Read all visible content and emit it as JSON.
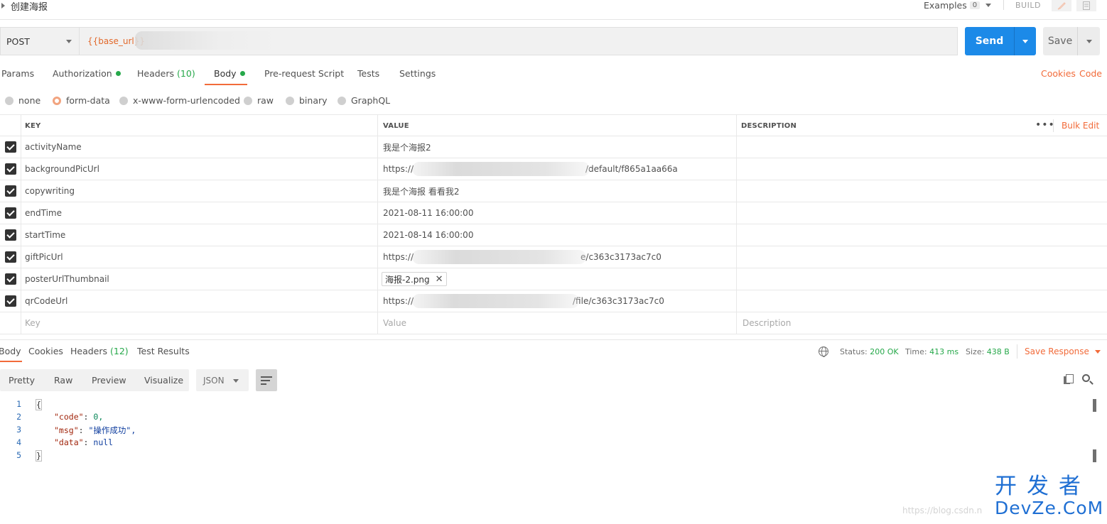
{
  "request": {
    "title": "创建海报",
    "examples_label": "Examples",
    "examples_count": "0",
    "build_label": "BUILD"
  },
  "url_bar": {
    "method": "POST",
    "url": "{{base_url}}",
    "send_label": "Send",
    "save_label": "Save"
  },
  "request_tabs": [
    {
      "label": "Params",
      "count": ""
    },
    {
      "label": "Authorization",
      "count": ""
    },
    {
      "label": "Headers",
      "count": "(10)"
    },
    {
      "label": "Body",
      "count": ""
    },
    {
      "label": "Pre-request Script",
      "count": ""
    },
    {
      "label": "Tests",
      "count": ""
    },
    {
      "label": "Settings",
      "count": ""
    }
  ],
  "links": {
    "cookies": "Cookies",
    "code": "Code"
  },
  "body_types": [
    "none",
    "form-data",
    "x-www-form-urlencoded",
    "raw",
    "binary",
    "GraphQL"
  ],
  "body_type_selected": "form-data",
  "table": {
    "headers": {
      "key": "KEY",
      "value": "VALUE",
      "description": "DESCRIPTION"
    },
    "bulk_edit": "Bulk Edit",
    "rows": [
      {
        "key": "activityName",
        "value": "我是个海报2"
      },
      {
        "key": "backgroundPicUrl",
        "value_start": "https://",
        "value_end": "/default/f865a1aa66a"
      },
      {
        "key": "copywriting",
        "value": "我是个海报  看看我2"
      },
      {
        "key": "endTime",
        "value": "2021-08-11 16:00:00"
      },
      {
        "key": "startTime",
        "value": "2021-08-14 16:00:00"
      },
      {
        "key": "giftPicUrl",
        "value_start": "https://",
        "value_end": "e/c363c3173ac7c0"
      },
      {
        "key": "posterUrlThumbnail",
        "file": "海报-2.png"
      },
      {
        "key": "qrCodeUrl",
        "value_start": "https://",
        "value_end": "/file/c363c3173ac7c0"
      }
    ],
    "placeholders": {
      "key": "Key",
      "value": "Value",
      "description": "Description"
    }
  },
  "response": {
    "tabs": [
      {
        "label": "Body",
        "count": ""
      },
      {
        "label": "Cookies",
        "count": ""
      },
      {
        "label": "Headers",
        "count": "(12)"
      },
      {
        "label": "Test Results",
        "count": ""
      }
    ],
    "status_label": "Status:",
    "status_value": "200 OK",
    "time_label": "Time:",
    "time_value": "413 ms",
    "size_label": "Size:",
    "size_value": "438 B",
    "save_response": "Save Response",
    "formats": [
      "Pretty",
      "Raw",
      "Preview",
      "Visualize"
    ],
    "language": "JSON",
    "code_lines": [
      {
        "num": "1",
        "key": "",
        "sep": "",
        "value": "{"
      },
      {
        "num": "2",
        "key": "\"code\"",
        "sep": ": ",
        "value": "0,"
      },
      {
        "num": "3",
        "key": "\"msg\"",
        "sep": ": ",
        "value": "\"操作成功\","
      },
      {
        "num": "4",
        "key": "\"data\"",
        "sep": ": ",
        "value": "null"
      },
      {
        "num": "5",
        "key": "",
        "sep": "",
        "value": "}"
      }
    ]
  },
  "watermark": {
    "url_text": "https://blog.csdn.n",
    "logo_cn": "开发者",
    "logo_en": "DevZe.CoM"
  },
  "colors": {
    "accent": "#f26b3a",
    "send_blue": "#1c8ae8",
    "success_green": "#26a84a"
  }
}
